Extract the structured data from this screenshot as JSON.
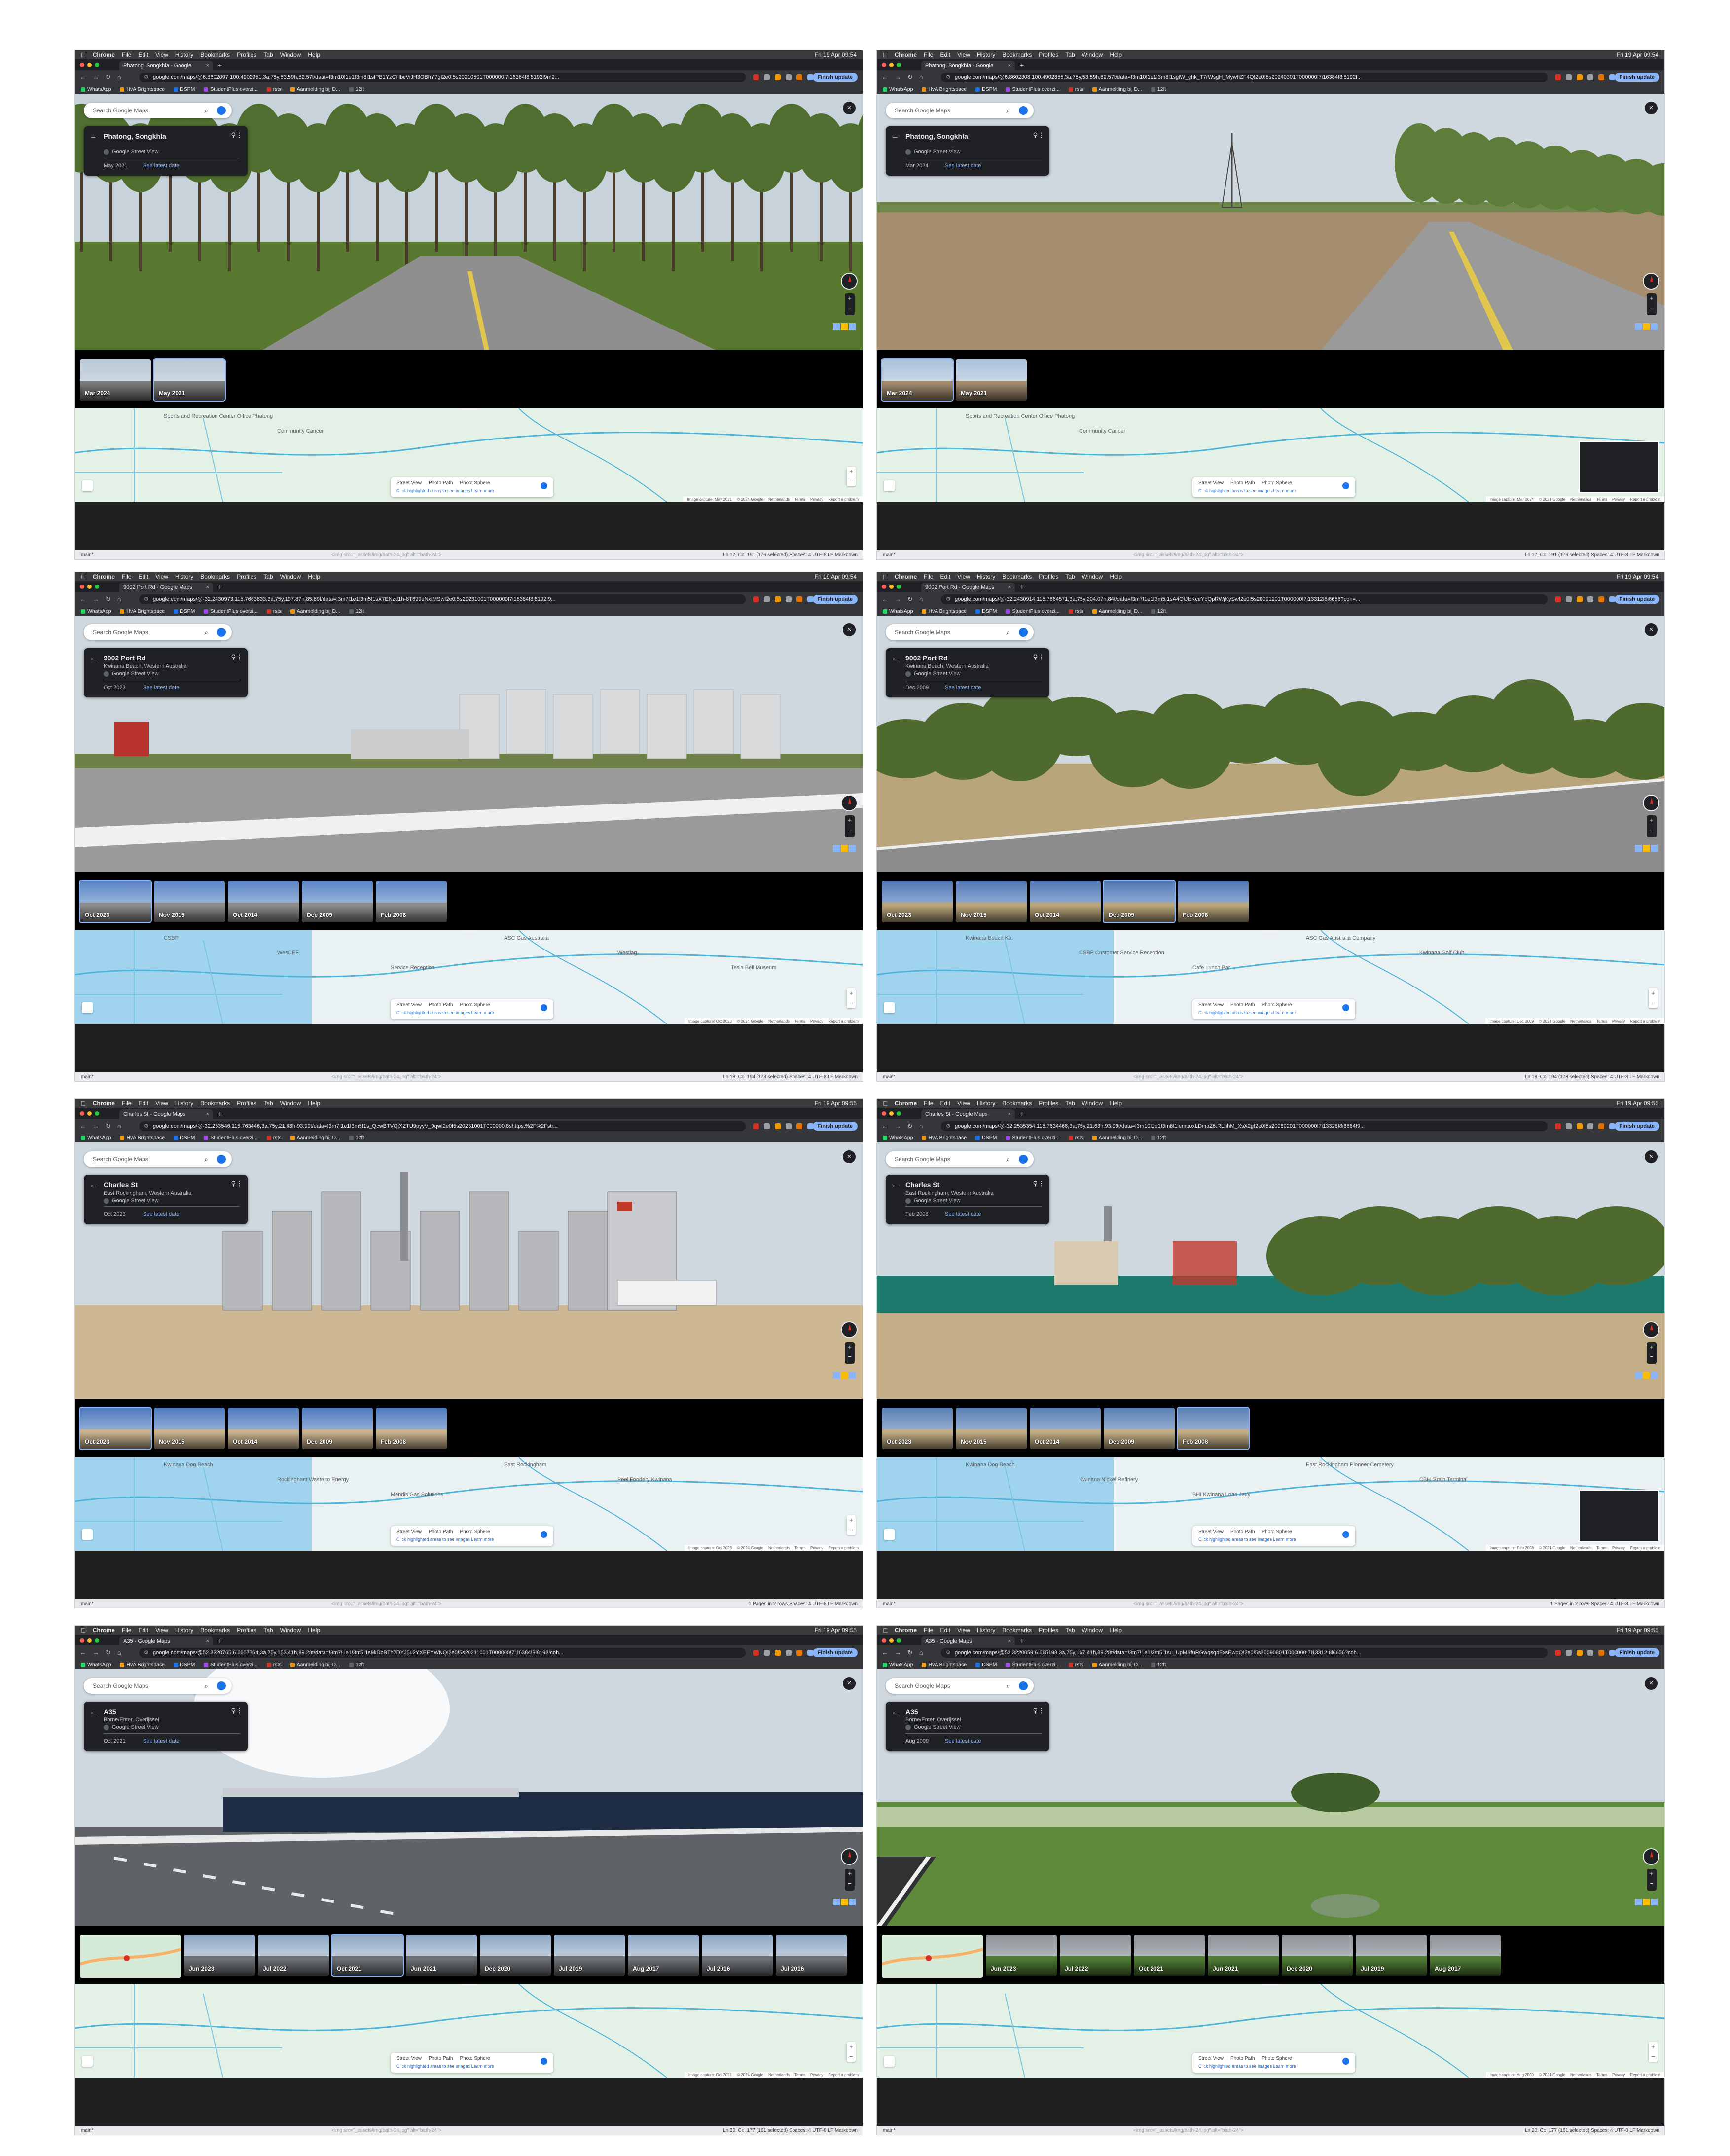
{
  "common": {
    "app_name": "Chrome",
    "menu_items": [
      "File",
      "Edit",
      "View",
      "History",
      "Bookmarks",
      "Profiles",
      "Tab",
      "Window",
      "Help"
    ],
    "bookmarks": [
      "WhatsApp",
      "HvA Brightspace",
      "DSPM",
      "StudentPlus overzi...",
      "rsts",
      "Aanmelding bij D...",
      "12ft"
    ],
    "finish_update": "Finish update",
    "search_placeholder": "Search Google Maps",
    "google_street_view": "Google Street View",
    "see_latest_date": "See latest date",
    "map_legend": {
      "street_view": "Street View",
      "photo_path": "Photo Path",
      "photo_sphere": "Photo Sphere",
      "hint": "Click highlighted areas to see images",
      "learn_more": "Learn more"
    },
    "attribution": [
      "© 2024 Google",
      "Netherlands",
      "Terms",
      "Privacy",
      "Report a problem"
    ],
    "status_code": "<img src=\"_assets/img/bath-24.jpg\" alt=\"bath-24\">",
    "status_encoding": [
      "Spaces: 4",
      "UTF-8",
      "LF",
      "Markdown"
    ],
    "timeline_label": "TIMELINE"
  },
  "panels": [
    {
      "tab_title": "Phatong, Songkhla - Google",
      "clock": "Fri 19 Apr 09:54",
      "url": "google.com/maps/@6.8602097,100.4902951,3a,75y,53.59h,82.57t/data=!3m10!1e1!3m8!1sIPB1YzChlbcViJH3OBhY7g!2e0!5s20210501T000000!7i16384!8i8192!9m2...",
      "location": "Phatong, Songkhla",
      "sublocation": "",
      "date": "May 2021",
      "thumbs": [
        "Mar 2024",
        "May 2021"
      ],
      "selected": 1,
      "map_labels": [
        "Sports and Recreation Center Office Phatong",
        "Community Cancer"
      ],
      "image_capture": "Image capture: May 2021",
      "status_left": "main*",
      "status_pos": "Ln 17, Col 191 (176 selected)"
    },
    {
      "tab_title": "Phatong, Songkhla - Google",
      "clock": "Fri 19 Apr 09:54",
      "url": "google.com/maps/@6.8602308,100.4902855,3a,75y,53.59h,82.57t/data=!3m10!1e1!3m8!1sglW_ghk_T7rWsgH_MywhZF4Q!2e0!5s20240301T000000!7i16384!8i8192!...",
      "location": "Phatong, Songkhla",
      "sublocation": "",
      "date": "Mar 2024",
      "thumbs": [
        "Mar 2024",
        "May 2021"
      ],
      "selected": 0,
      "map_labels": [
        "Sports and Recreation Center Office Phatong",
        "Community Cancer"
      ],
      "image_capture": "Image capture: Mar 2024",
      "status_left": "main*",
      "status_pos": "Ln 17, Col 191 (176 selected)"
    },
    {
      "tab_title": "9002 Port Rd - Google Maps",
      "clock": "Fri 19 Apr 09:54",
      "url": "google.com/maps/@-32.2430973,115.7663833,3a,75y,197.87h,85.89t/data=!3m7!1e1!3m5!1sX7ENzd1h-8T699eNxtMSw!2e0!5s20231001T000000!7i16384!8i8192!9...",
      "location": "9002 Port Rd",
      "sublocation": "Kwinana Beach, Western Australia",
      "date": "Oct 2023",
      "thumbs": [
        "Oct 2023",
        "Nov 2015",
        "Oct 2014",
        "Dec 2009",
        "Feb 2008"
      ],
      "selected": 0,
      "map_labels": [
        "CSBP",
        "WesCEF",
        "Service Reception",
        "ASC Gas Australia",
        "Westlag",
        "Tesla Bell Museum"
      ],
      "image_capture": "Image capture: Oct 2023",
      "status_left": "main*",
      "status_pos": "Ln 18, Col 194 (178 selected)"
    },
    {
      "tab_title": "9002 Port Rd - Google Maps",
      "clock": "Fri 19 Apr 09:54",
      "url": "google.com/maps/@-32.2430914,115.7664571,3a,75y,204.07h,84t/data=!3m7!1e1!3m5!1sA4OfJlcKceYbQpRWjKySw!2e0!5s20091201T000000!7i13312!8i6656?coh=...",
      "location": "9002 Port Rd",
      "sublocation": "Kwinana Beach, Western Australia",
      "date": "Dec 2009",
      "thumbs": [
        "Oct 2023",
        "Nov 2015",
        "Oct 2014",
        "Dec 2009",
        "Feb 2008"
      ],
      "selected": 3,
      "map_labels": [
        "Kwinana Beach Kb.",
        "CSBP Customer Service Reception",
        "Cafe Lunch Bar",
        "ASC Gas Australia Company",
        "Kwinana Golf Club"
      ],
      "image_capture": "Image capture: Dec 2009",
      "status_left": "main*",
      "status_pos": "Ln 18, Col 194 (178 selected)"
    },
    {
      "tab_title": "Charles St - Google Maps",
      "clock": "Fri 19 Apr 09:55",
      "url": "google.com/maps/@-32.253546,115.763446,3a,75y,21.63h,93.99t/data=!3m7!1e1!3m5!1s_QcwBTVQjXZTU9pyyV_9qw!2e0!5s20231001T000000!8shttps:%2F%2Fstr...",
      "location": "Charles St",
      "sublocation": "East Rockingham, Western Australia",
      "date": "Oct 2023",
      "thumbs": [
        "Oct 2023",
        "Nov 2015",
        "Oct 2014",
        "Dec 2009",
        "Feb 2008"
      ],
      "selected": 0,
      "map_labels": [
        "Kwinana Dog Beach",
        "Rockingham Waste to Energy",
        "Mendis Gas Solutions",
        "East Rockingham",
        "Peel Foodery Kwinana"
      ],
      "image_capture": "Image capture: Oct 2023",
      "status_left": "main*",
      "status_pos": "1 Pages in 2 rows"
    },
    {
      "tab_title": "Charles St - Google Maps",
      "clock": "Fri 19 Apr 09:55",
      "url": "google.com/maps/@-32.2535354,115.7634468,3a,75y,21.63h,93.99t/data=!3m10!1e1!3m8!1lemuoxLDmaZ6.RLhhM_XsX2g!2e0!5s20080201T000000!7i13328!8i6664!9...",
      "location": "Charles St",
      "sublocation": "East Rockingham, Western Australia",
      "date": "Feb 2008",
      "thumbs": [
        "Oct 2023",
        "Nov 2015",
        "Oct 2014",
        "Dec 2009",
        "Feb 2008"
      ],
      "selected": 4,
      "map_labels": [
        "Kwinana Dog Beach",
        "Kwinana Nickel Refinery",
        "BHI Kwinana Loan Jetty",
        "East Rockingham Pioneer Cemetery",
        "CBH Grain Terminal"
      ],
      "image_capture": "Image capture: Feb 2008",
      "status_left": "main*",
      "status_pos": "1 Pages in 2 rows"
    },
    {
      "tab_title": "A35 - Google Maps",
      "clock": "Fri 19 Apr 09:55",
      "url": "google.com/maps/@52.3220765,6.6657764,3a,75y,153.41h,89.28t/data=!3m7!1e1!3m5!1s9kDpBTh7DYJ5u2YXEEYWNQ!2e0!5s20211001T000000!7i16384!8i8192!coh...",
      "location": "A35",
      "sublocation": "Borne/Enter, Overijssel",
      "date": "Oct 2021",
      "thumbs": [
        "Jun 2023",
        "Jul 2022",
        "Oct 2021",
        "Jun 2021",
        "Dec 2020",
        "Jul 2019",
        "Aug 2017",
        "Jul 2016",
        "Jul 2016"
      ],
      "selected": 2,
      "map_labels": [],
      "image_capture": "Image capture: Oct 2021",
      "status_left": "main*",
      "status_pos": "Ln 20, Col 177 (161 selected)"
    },
    {
      "tab_title": "A35 - Google Maps",
      "clock": "Fri 19 Apr 09:55",
      "url": "google.com/maps/@52.3220059,6.665198,3a,75y,167.41h,89.28t/data=!3m7!1e1!3m5!1su_UpMSfuRGwqsq4ExsEwqQ!2e0!5s20090801T000000!7i13312!8i6656?coh...",
      "location": "A35",
      "sublocation": "Borne/Enter, Overijssel",
      "date": "Aug 2009",
      "thumbs": [
        "Jun 2023",
        "Jul 2022",
        "Oct 2021",
        "Jun 2021",
        "Dec 2020",
        "Jul 2019",
        "Aug 2017"
      ],
      "selected": 7,
      "map_labels": [],
      "image_capture": "Image capture: Aug 2009",
      "status_left": "main*",
      "status_pos": "Ln 20, Col 177 (161 selected)"
    }
  ],
  "colors": {
    "accent": "#8ab4f8",
    "traffic_red": "#ff5f57",
    "traffic_yellow": "#febc2e",
    "traffic_green": "#28c840"
  }
}
